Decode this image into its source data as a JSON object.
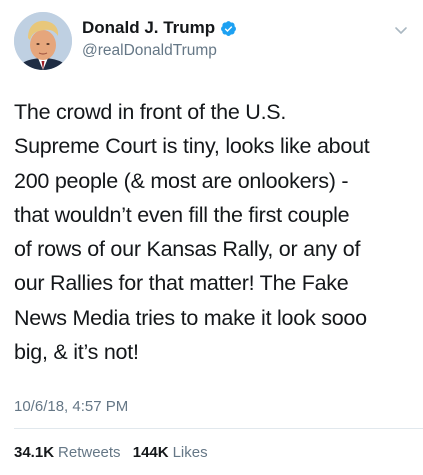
{
  "user": {
    "display_name": "Donald J. Trump",
    "handle": "@realDonaldTrump",
    "verified": true,
    "verified_color": "#1da1f2"
  },
  "tweet": {
    "text_lines": [
      "The crowd in front of the U.S.",
      "Supreme Court is tiny, looks like about",
      "200 people (& most are onlookers) -",
      "that wouldn’t even fill the first couple",
      "of rows of our Kansas Rally, or any of",
      "our Rallies for that matter! The Fake",
      "News Media tries to make it look sooo",
      "big, & it’s not!"
    ],
    "timestamp": "10/6/18, 4:57 PM"
  },
  "stats": {
    "retweets_count": "34.1K",
    "retweets_label": "Retweets",
    "likes_count": "144K",
    "likes_label": "Likes"
  },
  "icons": {
    "verified": "verified-badge-icon",
    "menu": "chevron-down-icon"
  },
  "colors": {
    "text_primary": "#14171a",
    "text_secondary": "#657786",
    "divider": "#e1e8ed"
  }
}
